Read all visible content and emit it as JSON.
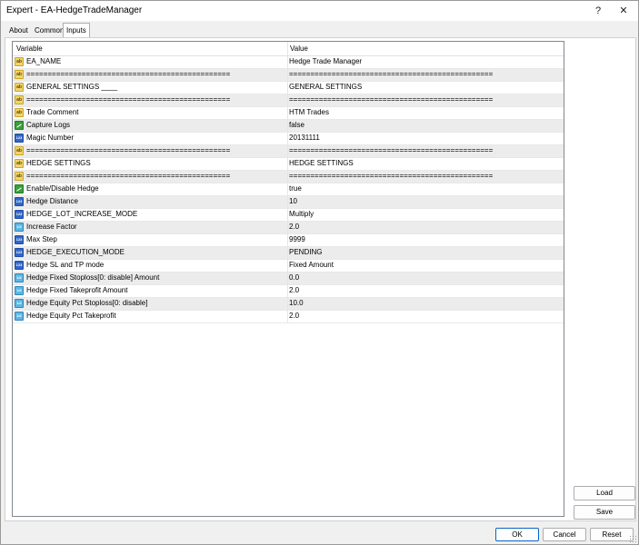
{
  "window": {
    "title": "Expert - EA-HedgeTradeManager",
    "help_glyph": "?",
    "close_glyph": "✕"
  },
  "tabs": [
    {
      "label": "About"
    },
    {
      "label": "Common"
    },
    {
      "label": "Inputs"
    }
  ],
  "grid": {
    "columns": [
      "Variable",
      "Value"
    ],
    "rows": [
      {
        "icon": "ab",
        "name": "EA_NAME",
        "value": "Hedge Trade Manager"
      },
      {
        "icon": "ab",
        "name": "================================================",
        "value": "================================================"
      },
      {
        "icon": "ab",
        "name": "GENERAL SETTINGS ____",
        "value": "GENERAL SETTINGS"
      },
      {
        "icon": "ab",
        "name": "================================================",
        "value": "================================================"
      },
      {
        "icon": "ab",
        "name": "Trade Comment",
        "value": "HTM Trades"
      },
      {
        "icon": "bool",
        "name": "Capture Logs",
        "value": "false"
      },
      {
        "icon": "123",
        "name": "Magic Number",
        "value": "20131111"
      },
      {
        "icon": "ab",
        "name": "================================================",
        "value": "================================================"
      },
      {
        "icon": "ab",
        "name": "HEDGE SETTINGS",
        "value": "HEDGE SETTINGS"
      },
      {
        "icon": "ab",
        "name": "================================================",
        "value": "================================================"
      },
      {
        "icon": "bool",
        "name": "Enable/Disable Hedge",
        "value": "true"
      },
      {
        "icon": "123",
        "name": "Hedge Distance",
        "value": "10"
      },
      {
        "icon": "123",
        "name": "HEDGE_LOT_INCREASE_MODE",
        "value": "Multiply"
      },
      {
        "icon": "dbl",
        "name": "Increase Factor",
        "value": "2.0"
      },
      {
        "icon": "123",
        "name": "Max Step",
        "value": "9999"
      },
      {
        "icon": "123",
        "name": "HEDGE_EXECUTION_MODE",
        "value": "PENDING"
      },
      {
        "icon": "123",
        "name": "Hedge SL and TP mode",
        "value": "Fixed Amount"
      },
      {
        "icon": "dbl",
        "name": "Hedge Fixed Stoploss[0: disable] Amount",
        "value": "0.0"
      },
      {
        "icon": "dbl",
        "name": "Hedge Fixed Takeprofit Amount",
        "value": "2.0"
      },
      {
        "icon": "dbl",
        "name": "Hedge Equity Pct Stoploss[0: disable]",
        "value": "10.0"
      },
      {
        "icon": "dbl",
        "name": "Hedge Equity Pct Takeprofit",
        "value": "2.0"
      }
    ]
  },
  "side_buttons": {
    "load": "Load",
    "save": "Save"
  },
  "bottom_buttons": {
    "ok": "OK",
    "cancel": "Cancel",
    "reset": "Reset"
  },
  "icon_labels": {
    "ab": "ab",
    "123": "123",
    "bool": "",
    "dbl": "1/2"
  }
}
